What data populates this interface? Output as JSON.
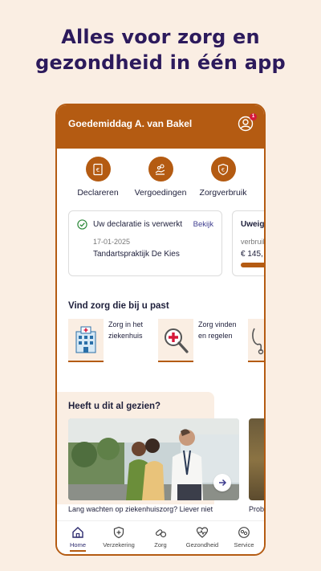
{
  "headline": {
    "line1": "Alles voor zorg en",
    "line2": "gezondheid in één app"
  },
  "appbar": {
    "greeting": "Goedemiddag A. van Bakel",
    "notification_count": "1"
  },
  "quick_actions": [
    {
      "label": "Declareren",
      "icon": "invoice-euro-icon"
    },
    {
      "label": "Vergoedingen",
      "icon": "hand-coins-icon"
    },
    {
      "label": "Zorgverbruik",
      "icon": "shield-euro-icon"
    }
  ],
  "cards": [
    {
      "title": "Uw declaratie is verwerkt",
      "link": "Bekijk",
      "date": "17-01-2025",
      "provider": "Tandartspraktijk De Kies"
    },
    {
      "title": "Uweig",
      "subtitle": "verbruik",
      "amount": "€ 145,",
      "progress": 0.4
    }
  ],
  "care_section": {
    "title": "Vind zorg die bij u past",
    "tiles": [
      {
        "label_line1": "Zorg in het",
        "label_line2": "ziekenhuis",
        "icon": "hospital-icon"
      },
      {
        "label_line1": "Zorg vinden",
        "label_line2": "en regelen",
        "icon": "magnifier-cross-icon"
      }
    ]
  },
  "news_section": {
    "title": "Heeft u dit al gezien?",
    "items": [
      {
        "caption": "Lang wachten op ziekenhuiszorg? Liever niet"
      },
      {
        "caption": "Prob"
      }
    ]
  },
  "tabbar": [
    {
      "label": "Home",
      "icon": "home-icon",
      "active": true
    },
    {
      "label": "Verzekering",
      "icon": "shield-plus-icon",
      "active": false
    },
    {
      "label": "Zorg",
      "icon": "pills-icon",
      "active": false
    },
    {
      "label": "Gezondheid",
      "icon": "heart-pulse-icon",
      "active": false
    },
    {
      "label": "Service",
      "icon": "chat-help-icon",
      "active": false
    }
  ],
  "colors": {
    "brand": "#b45b12",
    "background": "#faeee3",
    "headline": "#2c1a5c",
    "link": "#3e3d8f"
  }
}
